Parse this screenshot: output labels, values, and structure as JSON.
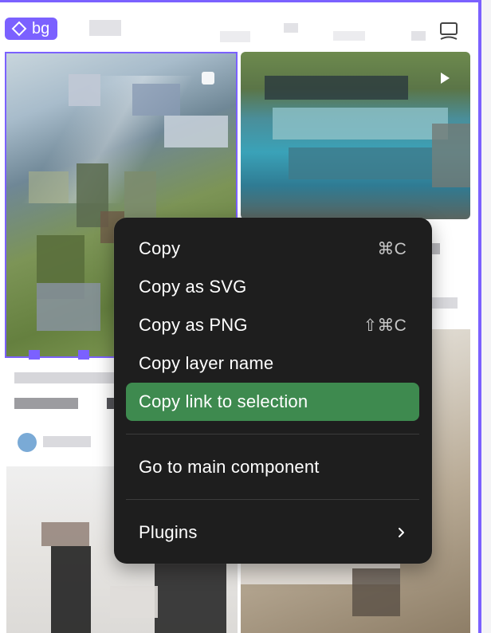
{
  "frame_tag": {
    "label": "bg",
    "icon": "component-diamond-icon",
    "color": "#7b61ff"
  },
  "context_menu": {
    "items": [
      {
        "label": "Copy",
        "shortcut": "⌘C",
        "active": false
      },
      {
        "label": "Copy as SVG",
        "shortcut": "",
        "active": false
      },
      {
        "label": "Copy as PNG",
        "shortcut": "⇧⌘C",
        "active": false
      },
      {
        "label": "Copy layer name",
        "shortcut": "",
        "active": false
      },
      {
        "label": "Copy link to selection",
        "shortcut": "",
        "active": true
      }
    ],
    "secondary": {
      "label": "Go to main component"
    },
    "plugins": {
      "label": "Plugins",
      "icon": "chevron-right-icon"
    },
    "colors": {
      "background": "#1e1e1e",
      "highlight": "#3e8a4f",
      "text": "#ffffff",
      "shortcut": "#c7c7c7"
    }
  }
}
